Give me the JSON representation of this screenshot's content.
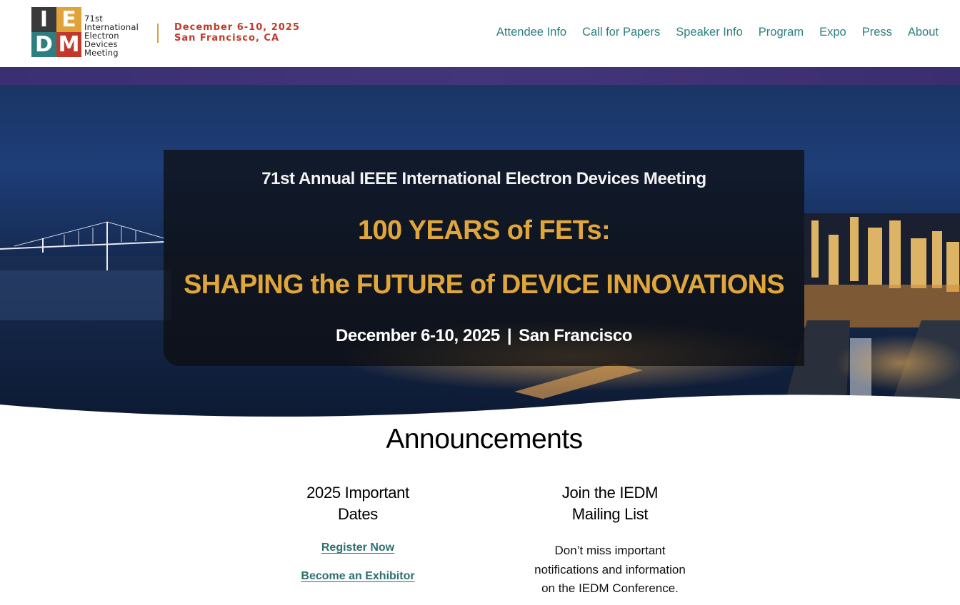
{
  "header": {
    "logo": {
      "letters": [
        "I",
        "E",
        "D",
        "M"
      ],
      "words": [
        "71st",
        "International",
        "Electron",
        "Devices",
        "Meeting"
      ],
      "colors": [
        "#3a3a3a",
        "#e0a33a",
        "#2d7f7f",
        "#c0392b"
      ]
    },
    "date_line": "December 6-10, 2025",
    "location_line": "San Francisco, CA",
    "nav": [
      "Attendee Info",
      "Call for Papers",
      "Speaker Info",
      "Program",
      "Expo",
      "Press",
      "About"
    ]
  },
  "hero": {
    "kicker": "71st Annual IEEE International Electron Devices Meeting",
    "title_line1": "100 YEARS of FETs:",
    "title_line2": "SHAPING the FUTURE of DEVICE INNOVATIONS",
    "dates": "December 6-10, 2025",
    "separator": "|",
    "city": "San Francisco"
  },
  "announcements": {
    "title": "Announcements",
    "left": {
      "heading_line1": "2025 Important",
      "heading_line2": "Dates",
      "link1": "Register Now",
      "link2": "Become an Exhibitor"
    },
    "right": {
      "heading_line1": "Join the IEDM",
      "heading_line2": "Mailing List",
      "text_line1": "Don’t miss important",
      "text_line2": "notifications and information",
      "text_line3": "on the IEDM Conference."
    }
  },
  "colors": {
    "accent_teal": "#2d7f7f",
    "accent_gold": "#e0a63a",
    "accent_red": "#c0392b",
    "band_purple": "#3a2f72"
  }
}
